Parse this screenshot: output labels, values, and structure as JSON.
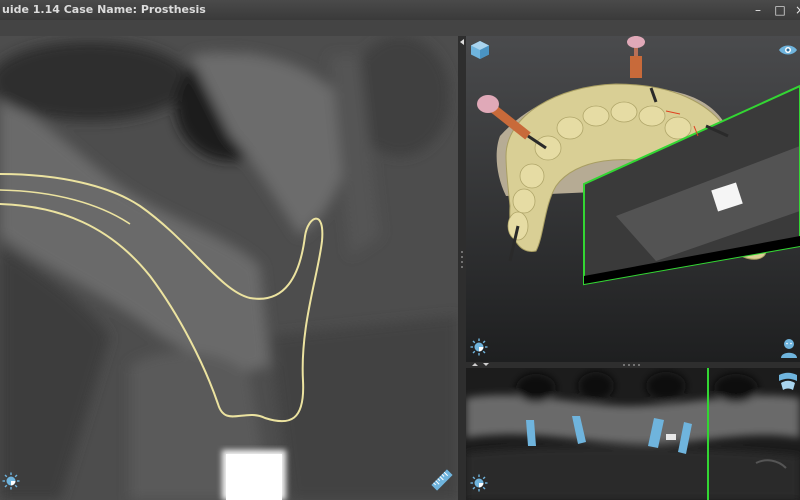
{
  "window": {
    "title": "uide 1.14 Case Name: Prosthesis",
    "controls": {
      "minimize": "–",
      "maximize": "□",
      "close": "×"
    }
  },
  "icons": {
    "cbct_view_toggle": "sun-icon",
    "ruler": "ruler-icon",
    "cube_3d": "cube-icon",
    "visibility": "eye-icon",
    "view3d_toggle": "sun-icon",
    "patient": "person-icon",
    "pano_toggle": "sun-icon",
    "pano_view": "curved-slice-icon",
    "collapse_arrow": "triangle-left-icon"
  },
  "colors": {
    "contour": "#ece3a0",
    "slice_frame": "#33d633",
    "model_teeth": "#d9cf95",
    "guide_sleeve": "#c86a3a",
    "implant_blue": "#6fb4dd",
    "icon_blue": "#6fb4dd"
  }
}
